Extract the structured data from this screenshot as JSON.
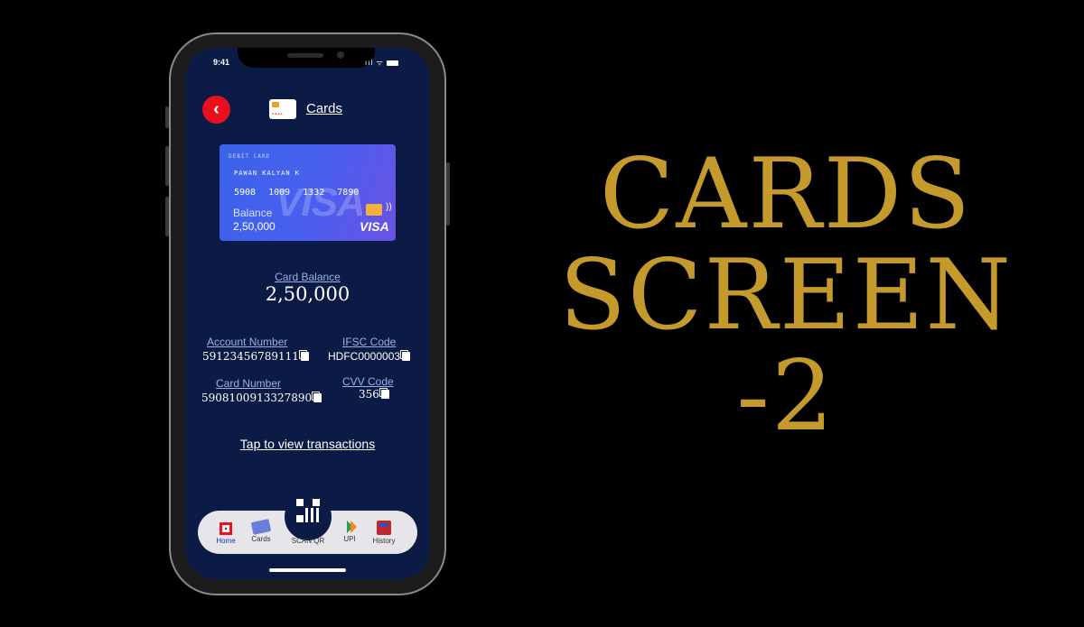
{
  "status_bar": {
    "time": "9:41",
    "signal_icons": "ııl ᯤ"
  },
  "header": {
    "back_icon": "back-arrow-icon",
    "card_icon": "card-icon",
    "title": "Cards"
  },
  "card": {
    "type": "DEBIT CARD",
    "holder": "PAWAN KALYAN K",
    "number_groups": [
      "5908",
      "1009",
      "1332",
      "7890"
    ],
    "watermark": "VISA",
    "balance_label": "Balance",
    "balance_value": "2,50,000",
    "network": "VISA",
    "nfc_symbol": "))"
  },
  "card_balance": {
    "label": "Card Balance",
    "value": "2,50,000"
  },
  "details": {
    "account_number": {
      "label": "Account Number",
      "value": "59123456789111"
    },
    "ifsc_code": {
      "label": "IFSC Code",
      "value": "HDFC0000003"
    },
    "card_number": {
      "label": "Card Number",
      "value": "5908100913327890"
    },
    "cvv_code": {
      "label": "CVV Code",
      "value": "356"
    }
  },
  "transactions_link": "Tap to view transactions",
  "bottom_nav": {
    "items": [
      {
        "label": "Home",
        "icon": "home-icon"
      },
      {
        "label": "Cards",
        "icon": "cards-icon"
      },
      {
        "label": "SCAN QR",
        "icon": "qr-code-icon"
      },
      {
        "label": "UPI",
        "icon": "upi-icon"
      },
      {
        "label": "History",
        "icon": "history-icon"
      }
    ]
  },
  "banner": {
    "line1": "CARDS",
    "line2": "SCREEN",
    "line3": "-2"
  },
  "colors": {
    "background": "#000000",
    "screen_bg": "#0b1b45",
    "accent_red": "#e8101f",
    "gold": "#c59a2c",
    "card_blue": "#3a64e8"
  }
}
